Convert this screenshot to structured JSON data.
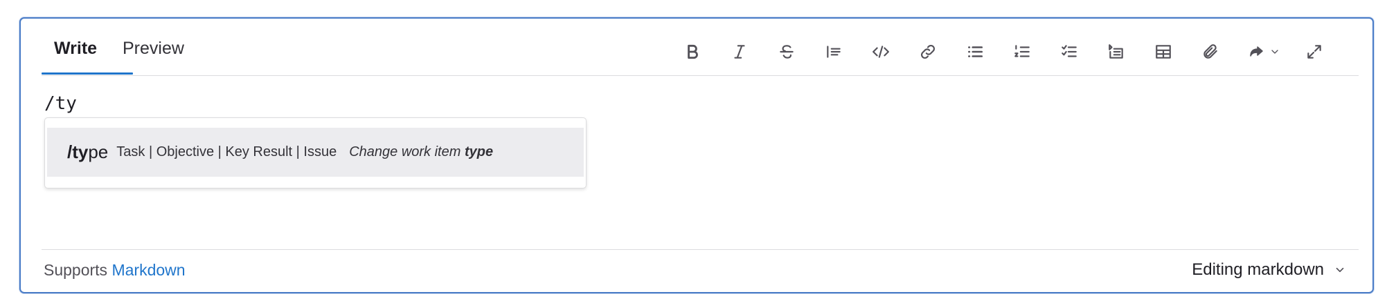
{
  "tabs": {
    "write": "Write",
    "preview": "Preview"
  },
  "toolbar": {
    "icons": [
      "bold-icon",
      "italic-icon",
      "strikethrough-icon",
      "quote-icon",
      "code-icon",
      "link-icon",
      "bullet-list-icon",
      "numbered-list-icon",
      "task-list-icon",
      "collapsible-section-icon",
      "table-icon",
      "attach-file-icon",
      "quick-actions-icon",
      "fullscreen-icon"
    ]
  },
  "editor": {
    "text": "/ty"
  },
  "autocomplete": {
    "command_match": "/ty",
    "command_rest": "pe",
    "params": "Task | Objective | Key Result | Issue",
    "description_prefix": "Change work item ",
    "description_bold": "type"
  },
  "footer": {
    "supports_prefix": "Supports ",
    "markdown_link": "Markdown",
    "editing_mode": "Editing markdown"
  },
  "colors": {
    "accent": "#1f75cb",
    "focus_border": "#4a7cc7",
    "selected_item_bg": "#ececef"
  }
}
